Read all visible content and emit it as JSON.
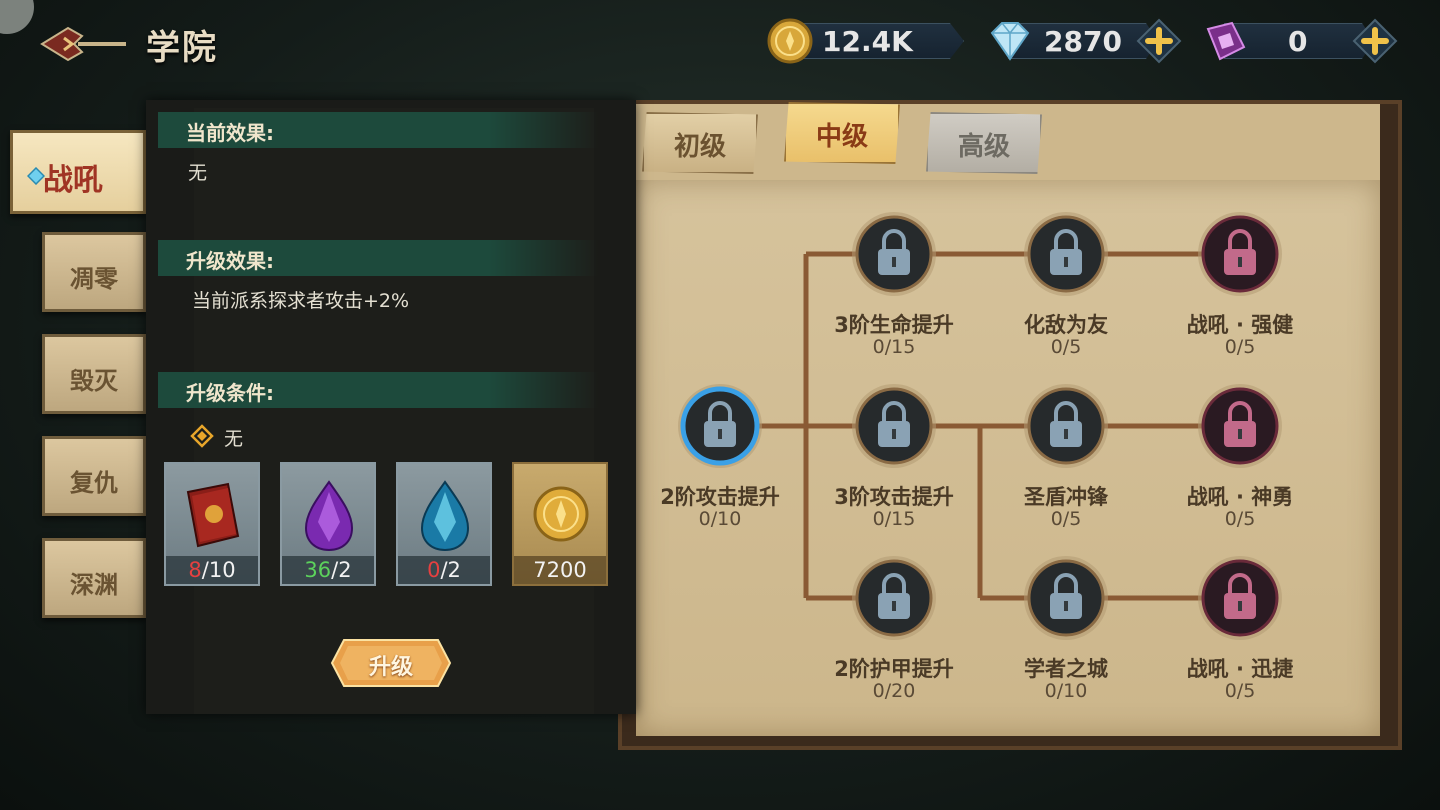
{
  "header": {
    "title": "学院",
    "back_icon": "back-arrow-icon"
  },
  "resources": {
    "coin": {
      "value": "12.4K",
      "icon": "gold-coin-icon"
    },
    "diamond": {
      "value": "2870",
      "icon": "diamond-icon"
    },
    "crystal": {
      "value": "0",
      "icon": "purple-crystal-icon"
    }
  },
  "side_tabs": [
    "战吼",
    "凋零",
    "毁灭",
    "复仇",
    "深渊"
  ],
  "active_side_tab": "战吼",
  "panel": {
    "current_effect_label": "当前效果:",
    "current_effect_value": "无",
    "upgrade_effect_label": "升级效果:",
    "upgrade_effect_value": "当前派系探求者攻击+2%",
    "upgrade_condition_label": "升级条件:",
    "upgrade_condition_value": "无",
    "materials": [
      {
        "name": "red-book",
        "have": "8",
        "need": "/10",
        "have_color": "#e64040"
      },
      {
        "name": "purple-gem",
        "have": "36",
        "need": "/2",
        "have_color": "#5cd25c"
      },
      {
        "name": "blue-gem",
        "have": "0",
        "need": "/2",
        "have_color": "#e64040"
      },
      {
        "name": "gold-coin",
        "have": "7200",
        "need": "",
        "have_color": "#f2f2f2"
      }
    ],
    "upgrade_button": "升级"
  },
  "level_tabs": [
    "初级",
    "中级",
    "高级"
  ],
  "active_level_tab": "中级",
  "tree": [
    {
      "id": "n1",
      "label": "2阶攻击提升",
      "progress": "0/10",
      "selected": true,
      "elite": false
    },
    {
      "id": "n2",
      "label": "3阶生命提升",
      "progress": "0/15",
      "selected": false,
      "elite": false
    },
    {
      "id": "n3",
      "label": "3阶攻击提升",
      "progress": "0/15",
      "selected": false,
      "elite": false
    },
    {
      "id": "n4",
      "label": "2阶护甲提升",
      "progress": "0/20",
      "selected": false,
      "elite": false
    },
    {
      "id": "n5",
      "label": "化敌为友",
      "progress": "0/5",
      "selected": false,
      "elite": false
    },
    {
      "id": "n6",
      "label": "圣盾冲锋",
      "progress": "0/5",
      "selected": false,
      "elite": false
    },
    {
      "id": "n7",
      "label": "学者之城",
      "progress": "0/10",
      "selected": false,
      "elite": false
    },
    {
      "id": "n8",
      "label": "战吼 · 强健",
      "progress": "0/5",
      "selected": false,
      "elite": true
    },
    {
      "id": "n9",
      "label": "战吼 · 神勇",
      "progress": "0/5",
      "selected": false,
      "elite": true
    },
    {
      "id": "n10",
      "label": "战吼 · 迅捷",
      "progress": "0/5",
      "selected": false,
      "elite": true
    }
  ],
  "colors": {
    "accent_green": "#1d4a3c",
    "parchment": "#d6c39c",
    "link_line": "#8a5a34",
    "selected_ring": "#3aa0e6"
  }
}
